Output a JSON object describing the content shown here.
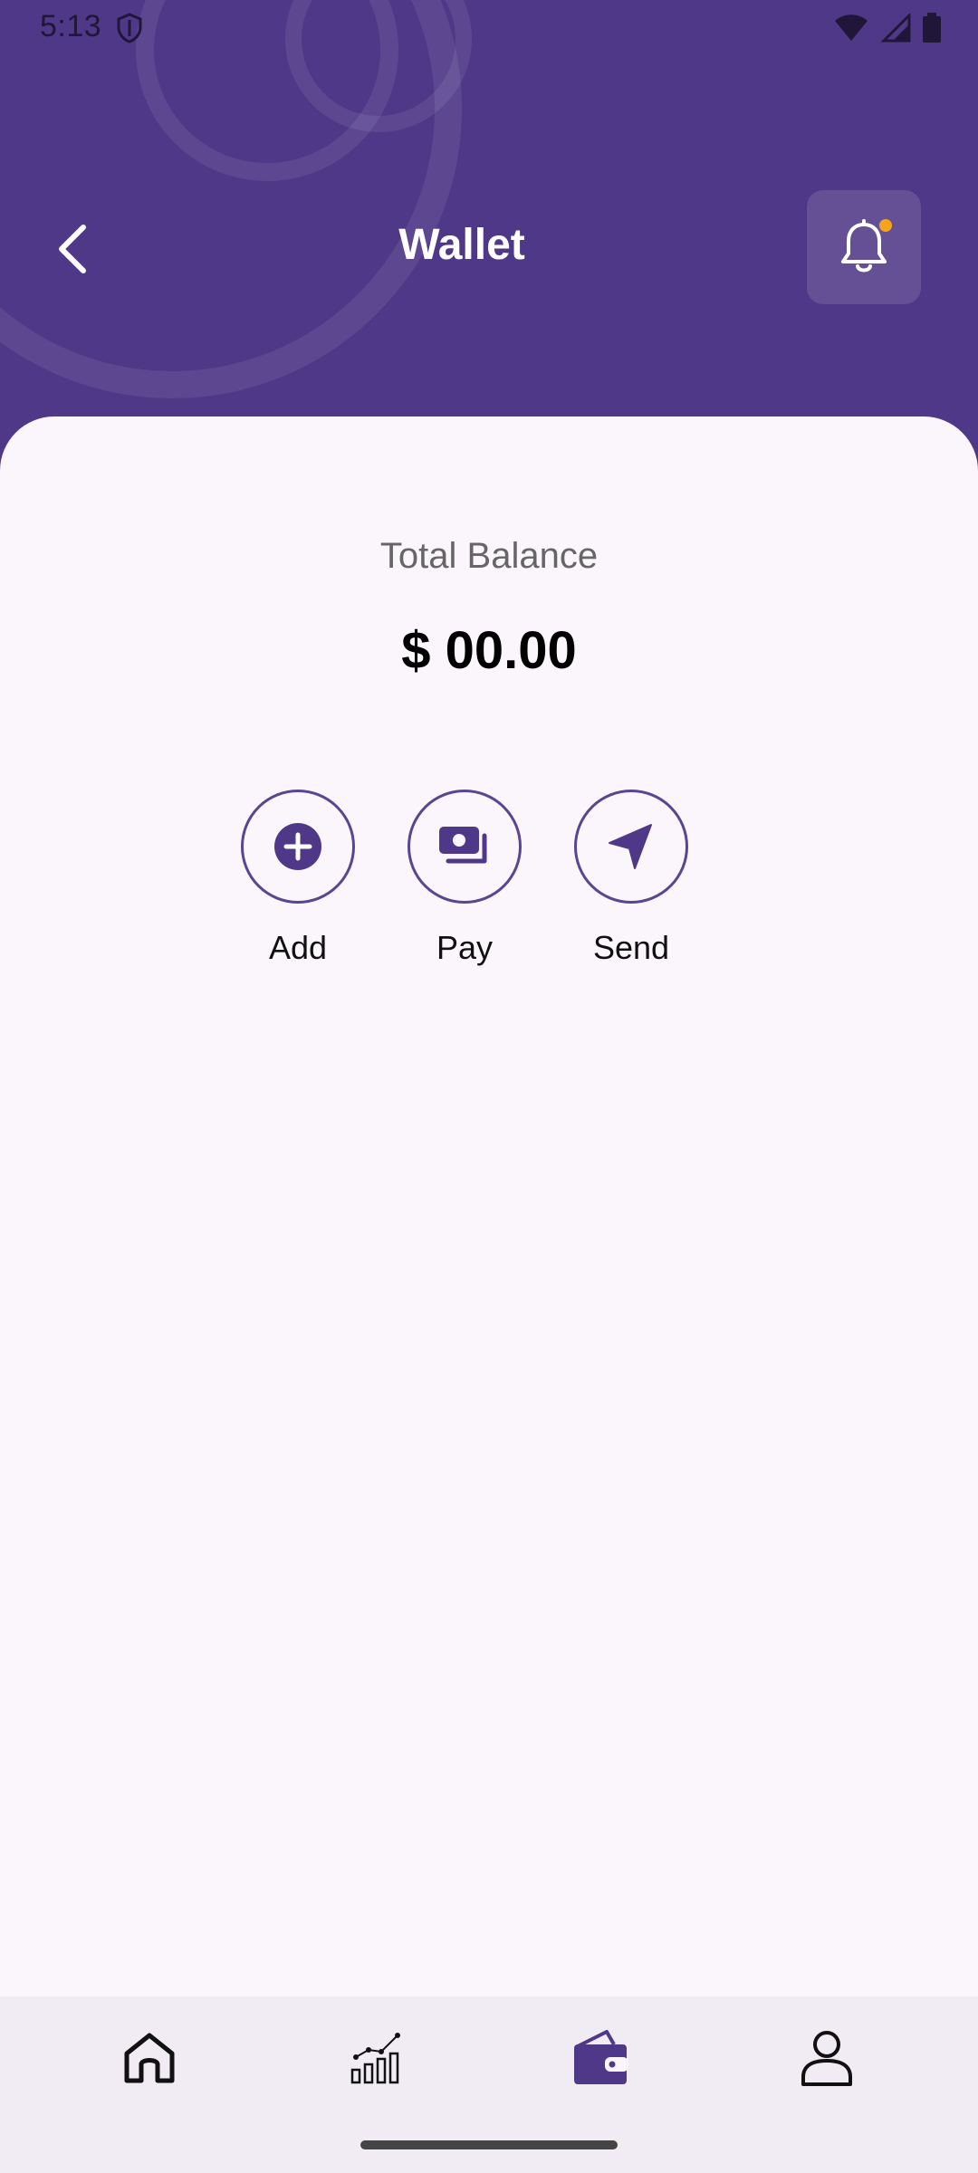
{
  "status_bar": {
    "time": "5:13"
  },
  "header": {
    "title": "Wallet"
  },
  "balance": {
    "label": "Total Balance",
    "amount": "$ 00.00"
  },
  "actions": [
    {
      "label": "Add",
      "icon": "add-circle-icon"
    },
    {
      "label": "Pay",
      "icon": "cash-icon"
    },
    {
      "label": "Send",
      "icon": "send-arrow-icon"
    }
  ],
  "bottom_nav": [
    {
      "icon": "home-icon",
      "active": false
    },
    {
      "icon": "chart-icon",
      "active": false
    },
    {
      "icon": "wallet-icon",
      "active": true
    },
    {
      "icon": "profile-icon",
      "active": false
    }
  ],
  "colors": {
    "primary": "#503888",
    "notification_dot": "#f6a51a",
    "background": "#fbf6fc"
  }
}
